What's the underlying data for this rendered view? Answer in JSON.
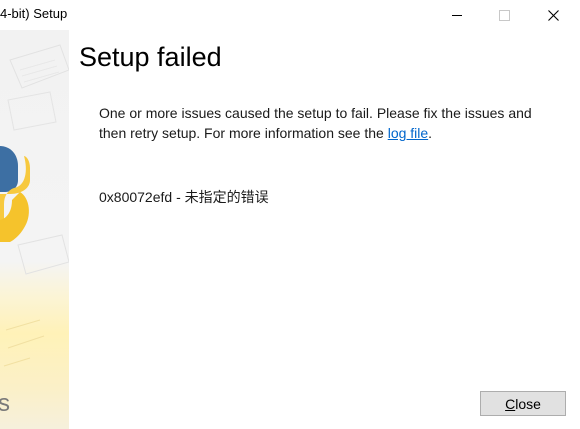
{
  "window": {
    "title": "4-bit) Setup"
  },
  "side": {
    "letter": "s"
  },
  "main": {
    "heading": "Setup failed",
    "message_prefix": "One or more issues caused the setup to fail. Please fix the issues and then retry setup. For more information see the ",
    "log_link": "log file",
    "message_suffix": ".",
    "error": "0x80072efd - 未指定的错误"
  },
  "buttons": {
    "close_accel": "C",
    "close_rest": "lose"
  },
  "colors": {
    "link": "#0066cc",
    "button_bg": "#e1e1e1",
    "button_border": "#adadad"
  }
}
